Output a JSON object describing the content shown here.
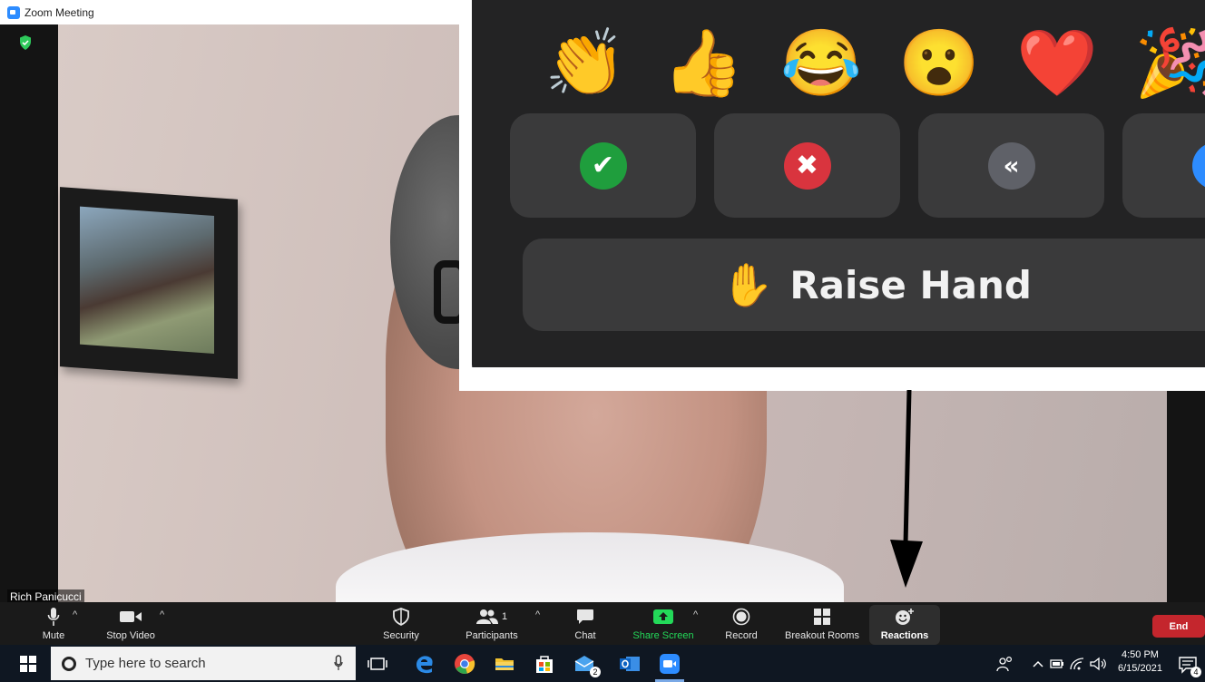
{
  "window": {
    "title": "Zoom Meeting"
  },
  "video": {
    "participant_name": "Rich Panicucci"
  },
  "reactions_panel": {
    "emojis": [
      "👏",
      "👍",
      "😂",
      "😮",
      "❤️",
      "🎉"
    ],
    "status_buttons": [
      {
        "name": "yes",
        "symbol": "✔",
        "color": "#1f9e3d"
      },
      {
        "name": "no",
        "symbol": "✖",
        "color": "#d9343e"
      },
      {
        "name": "slower",
        "symbol": "«",
        "color": "#5f6168"
      }
    ],
    "raise_hand_label": "Raise Hand",
    "raise_hand_emoji": "✋"
  },
  "toolbar": {
    "mute_label": "Mute",
    "stop_video_label": "Stop Video",
    "security_label": "Security",
    "participants_label": "Participants",
    "participants_count": "1",
    "chat_label": "Chat",
    "share_screen_label": "Share Screen",
    "record_label": "Record",
    "breakout_rooms_label": "Breakout Rooms",
    "reactions_label": "Reactions",
    "end_label": "End"
  },
  "taskbar": {
    "search_placeholder": "Type here to search",
    "mail_badge": "2",
    "notification_badge": "4",
    "time": "4:50 PM",
    "date": "6/15/2021"
  }
}
